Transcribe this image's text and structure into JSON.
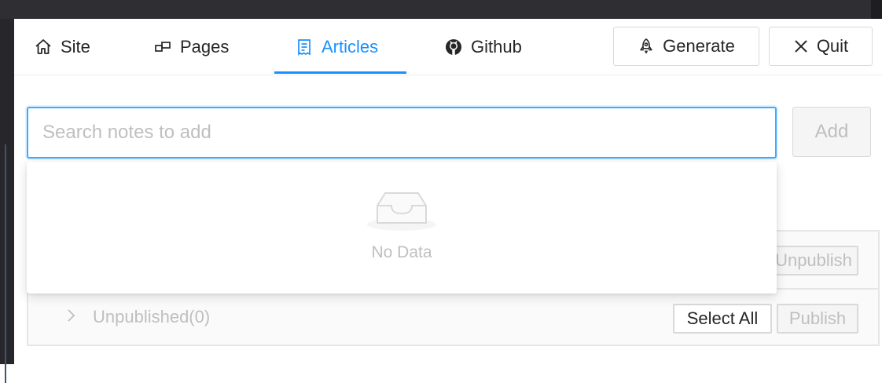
{
  "tabs": [
    {
      "label": "Site",
      "icon": "home-icon",
      "active": false
    },
    {
      "label": "Pages",
      "icon": "pages-icon",
      "active": false
    },
    {
      "label": "Articles",
      "icon": "document-icon",
      "active": true
    },
    {
      "label": "Github",
      "icon": "github-icon",
      "active": false
    }
  ],
  "actions": {
    "generate_label": "Generate",
    "generate_icon": "rocket-icon",
    "quit_label": "Quit",
    "quit_icon": "close-icon"
  },
  "search": {
    "placeholder": "Search notes to add",
    "value": "",
    "add_label": "Add"
  },
  "dropdown": {
    "empty_text": "No Data",
    "empty_icon": "inbox-icon"
  },
  "published_panel": {
    "unpublish_label": "Unpublish"
  },
  "unpublished_panel": {
    "title": "Unpublished(0)",
    "select_all_label": "Select All",
    "publish_label": "Publish"
  },
  "colors": {
    "accent": "#1890ff",
    "titlebar": "#2f2f33",
    "disabled_text": "#bfbfbf"
  }
}
